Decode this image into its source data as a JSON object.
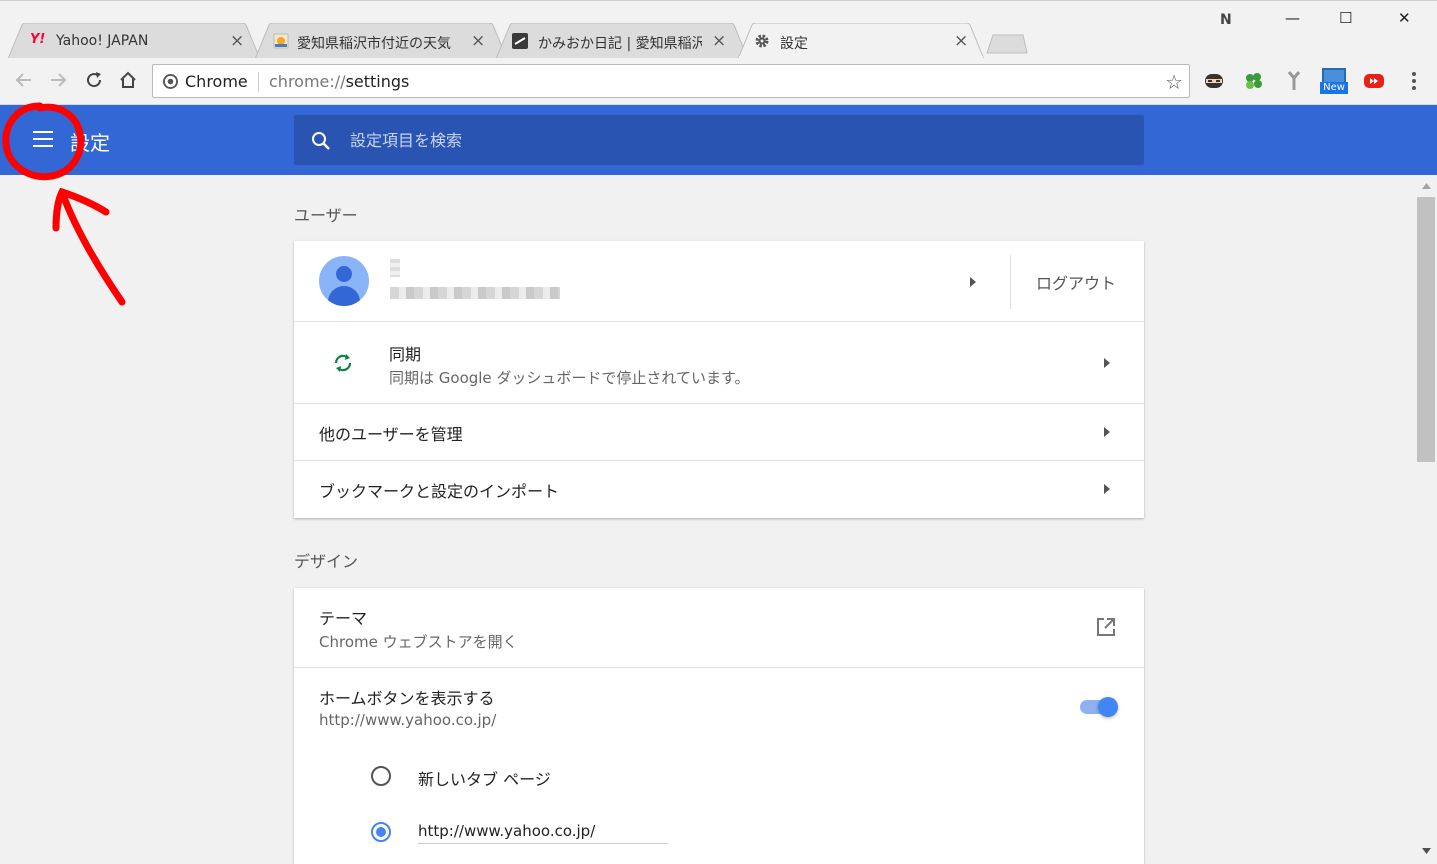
{
  "tabs": [
    {
      "title": "Yahoo! JAPAN"
    },
    {
      "title": "愛知県稲沢市付近の天気"
    },
    {
      "title": "かみおか日記 | 愛知県稲沢"
    },
    {
      "title": "設定"
    }
  ],
  "window": {
    "ext_label": "N",
    "minimize": "—",
    "maximize": "☐",
    "close": "✕"
  },
  "omnibox": {
    "chip": "Chrome",
    "url_scheme": "chrome://",
    "url_path": "settings"
  },
  "extensions": {
    "new_badge": "New"
  },
  "header": {
    "title": "設定",
    "search_placeholder": "設定項目を検索"
  },
  "users": {
    "section_title": "ユーザー",
    "logout": "ログアウト",
    "sync_title": "同期",
    "sync_sub": "同期は Google ダッシュボードで停止されています。",
    "manage": "他のユーザーを管理",
    "import": "ブックマークと設定のインポート"
  },
  "design": {
    "section_title": "デザイン",
    "theme_title": "テーマ",
    "theme_sub": "Chrome ウェブストアを開く",
    "home_title": "ホームボタンを表示する",
    "home_sub": "http://www.yahoo.co.jp/",
    "home_toggle_on": true,
    "radio_newtab": "新しいタブ ページ",
    "radio_url_value": "http://www.yahoo.co.jp/"
  },
  "colors": {
    "header": "#3367d6",
    "accent": "#4285f4",
    "annotation": "#ff0000"
  }
}
